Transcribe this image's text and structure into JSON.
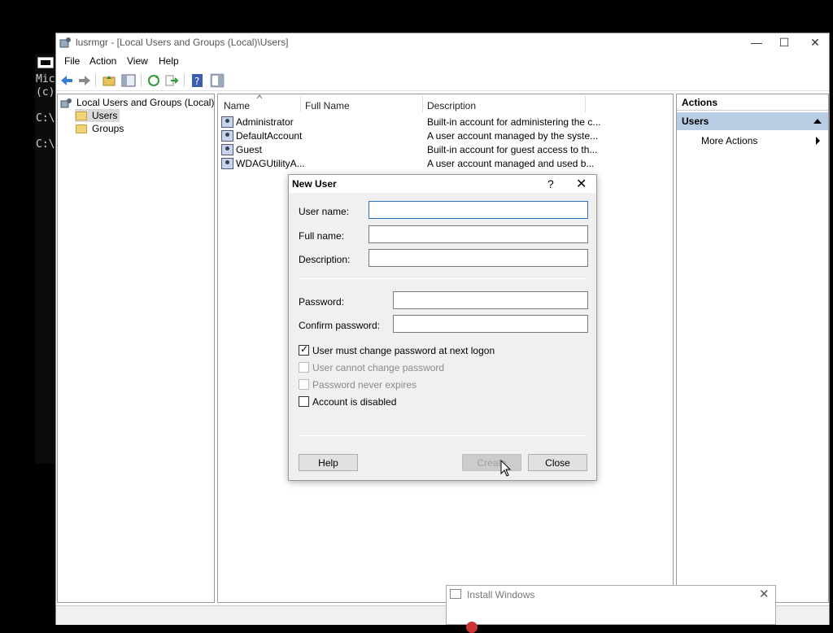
{
  "console": {
    "lines": [
      "Mic",
      "(c)",
      "C:\\",
      "C:\\"
    ]
  },
  "window": {
    "title": "lusrmgr - [Local Users and Groups (Local)\\Users]",
    "minimize": "—",
    "maximize": "☐",
    "close": "✕"
  },
  "menu": {
    "file": "File",
    "action": "Action",
    "view": "View",
    "help": "Help"
  },
  "tree": {
    "root": "Local Users and Groups (Local)",
    "items": [
      "Users",
      "Groups"
    ]
  },
  "list": {
    "columns": [
      "Name",
      "Full Name",
      "Description"
    ],
    "rows": [
      {
        "name": "Administrator",
        "full_name": "",
        "description": "Built-in account for administering the c..."
      },
      {
        "name": "DefaultAccount",
        "full_name": "",
        "description": "A user account managed by the syste..."
      },
      {
        "name": "Guest",
        "full_name": "",
        "description": "Built-in account for guest access to th..."
      },
      {
        "name": "WDAGUtilityA...",
        "full_name": "",
        "description": "A user account managed and used b..."
      }
    ]
  },
  "actions": {
    "header": "Actions",
    "section": "Users",
    "more": "More Actions"
  },
  "dialog": {
    "title": "New User",
    "help_glyph": "?",
    "close_glyph": "✕",
    "user_name_label": "User name:",
    "user_name_value": "",
    "full_name_label": "Full name:",
    "full_name_value": "",
    "description_label": "Description:",
    "description_value": "",
    "password_label": "Password:",
    "password_value": "",
    "confirm_label": "Confirm password:",
    "confirm_value": "",
    "must_change": {
      "label": "User must change password at next logon",
      "checked": true,
      "enabled": true
    },
    "cannot_change": {
      "label": "User cannot change password",
      "checked": false,
      "enabled": false
    },
    "never_expires": {
      "label": "Password never expires",
      "checked": false,
      "enabled": false
    },
    "disabled": {
      "label": "Account is disabled",
      "checked": false,
      "enabled": true
    },
    "help_button": "Help",
    "create_button": "Create",
    "close_button": "Close"
  },
  "install": {
    "title": "Install Windows",
    "close_glyph": "✕"
  },
  "colors": {
    "actions_section": "#b8cce4",
    "focus_border": "#2b6fbf"
  }
}
